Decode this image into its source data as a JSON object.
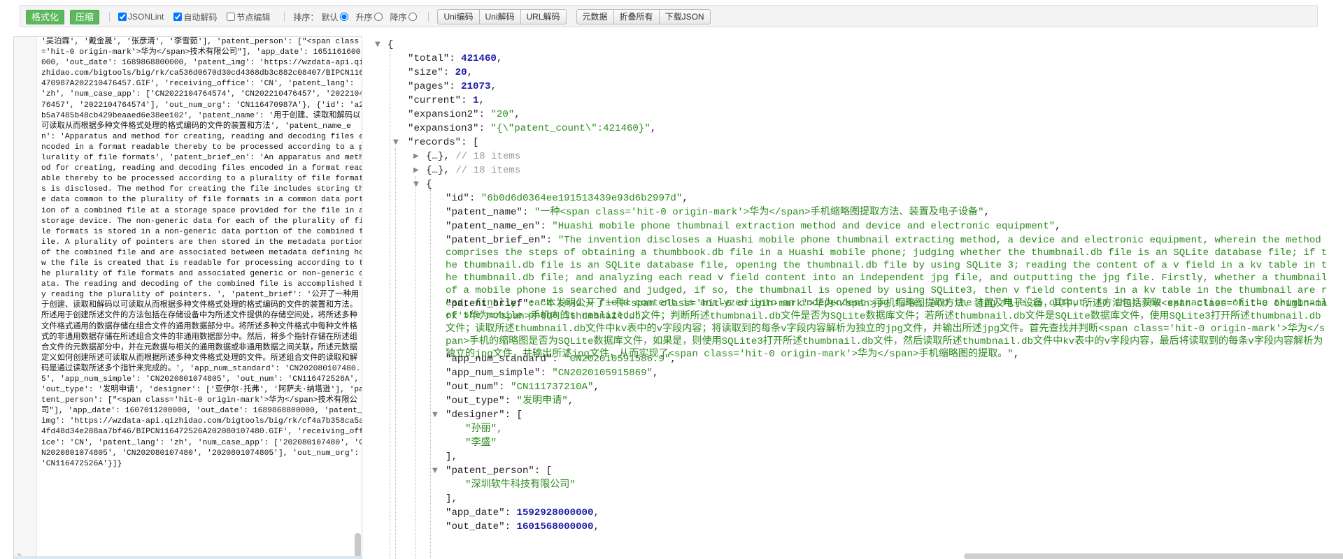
{
  "toolbar": {
    "format_label": "格式化",
    "compress_label": "压缩",
    "jsonlint_label": "JSONLint",
    "auto_decode_label": "自动解码",
    "node_edit_label": "节点编辑",
    "sort_label": "排序：",
    "sort_default": "默认",
    "sort_asc": "升序",
    "sort_desc": "降序",
    "uni_encode": "Uni编码",
    "uni_decode": "Uni解码",
    "url_decode": "URL解码",
    "raw_data": "元数据",
    "collapse_all": "折叠所有",
    "download_json": "下载JSON"
  },
  "left_editor": {
    "line_number": "2",
    "raw_text": "'吴泊霖', '戴金晟', '张彦清', '李雪茹'], 'patent_person': [\"<span class='hit-0 origin-mark'>华为</span>技术有限公司\"], 'app_date': 1651161600000, 'out_date': 1689868800000, 'patent_img': 'https://wzdata-api.qizhidao.com/bigtools/big/rk/ca536d0670d30cd4368db3c882c08407/BIPCN116470987A202210476457.GIF', 'receiving_office': 'CN', 'patent_lang': 'zh', 'num_case_app': ['CN2022104764574', 'CN202210476457', '202210476457', '2022104764574'], 'out_num_org': 'CN116470987A'}, {'id': 'a2b5a7485b48cb429beaaed6e38ee102', 'patent_name': '用于创建、读取和解码以可读取从而根据多种文件格式处理的格式编码的文件的装置和方法', 'patent_name_en': 'Apparatus and method for creating, reading and decoding files encoded in a format readable thereby to be processed according to a plurality of file formats', 'patent_brief_en': 'An apparatus and method for creating, reading and decoding files encoded in a format readable thereby to be processed according to a plurality of file formats is disclosed. The method for creating the file includes storing the data common to the plurality of file formats in a common data portion of a combined file at a storage space provided for the file in a storage device. The non-generic data for each of the plurality of file formats is stored in a non-generic data portion of the combined file. A plurality of pointers are then stored in the metadata portion of the combined file and are associated between metadata defining how the file is created that is readable for processing according to the plurality of file formats and associated generic or non-generic data. The reading and decoding of the combined file is accomplished by reading the plurality of pointers. ', 'patent_brief': '公开了一种用于创建、读取和解码以可读取从而根据多种文件格式处理的格式编码的文件的装置和方法。所述用于创建所述文件的方法包括在存储设备中为所述文件提供的存储空间处，将所述多种文件格式通用的数据存储在组合文件的通用数据部分中。将所述多种文件格式中每种文件格式的非通用数据存储在所述组合文件的非通用数据部分中。然后，将多个指针存储在所述组合文件的元数据部分中，并在元数据与相关的通用数据或非通用数据之间关联，所述元数据定义如何创建所述可读取从而根据所述多种文件格式处理的文件。所述组合文件的读取和解码是通过读取所述多个指针来完成的。', 'app_num_standard': 'CN202080107480.5', 'app_num_simple': 'CN2020801074805', 'out_num': 'CN116472526A', 'out_type': '发明申请', 'designer': ['亚伊尔·托弗', '阿萨夫·纳塔逊'], 'patent_person': [\"<span class='hit-0 origin-mark'>华为</span>技术有限公司\"], 'app_date': 1607011200000, 'out_date': 1689868800000, 'patent_img': 'https://wzdata-api.qizhidao.com/bigtools/big/rk/cf4a7b358ca5a4fd48d34e288aa7bf46/BIPCN116472526A202080107480.GIF', 'receiving_office': 'CN', 'patent_lang': 'zh', 'num_case_app': ['202080107480', 'CN2020801074805', 'CN202080107480', '2020801074805'], 'out_num_org': 'CN116472526A'}]}"
  },
  "tree": {
    "open_brace": "{",
    "close_brace": "}",
    "total_key": "\"total\"",
    "total_val": "421460",
    "size_key": "\"size\"",
    "size_val": "20",
    "pages_key": "\"pages\"",
    "pages_val": "21073",
    "current_key": "\"current\"",
    "current_val": "1",
    "expansion2_key": "\"expansion2\"",
    "expansion2_val": "\"20\"",
    "expansion3_key": "\"expansion3\"",
    "expansion3_val": "\"{\\\"patent_count\\\":421460}\"",
    "records_key": "\"records\"",
    "records_open": "[",
    "collapsed_obj": "{…},",
    "collapsed_comment": "// 18 items",
    "id_key": "\"id\"",
    "id_val": "\"6b0d6d0364ee191513439e93d6b2997d\"",
    "patent_name_key": "\"patent_name\"",
    "patent_name_val": "\"一种<span class='hit-0 origin-mark'>华为</span>手机缩略图提取方法、装置及电子设备\"",
    "patent_name_en_key": "\"patent_name_en\"",
    "patent_name_en_val": "\"Huashi mobile phone thumbnail extraction method and device and electronic equipment\"",
    "patent_brief_en_key": "\"patent_brief_en\"",
    "patent_brief_en_val": "\"The invention discloses a Huashi mobile phone thumbnail extracting method, a device and electronic equipment, wherein the method comprises the steps of obtaining a thumbbook.db file in a Huashi mobile phone; judging whether the thumbnail.db file is an SQLite database file; if the thumbnail.db file is an SQLite database file, opening the thumbnail.db file by using SQLite 3; reading the content of a v field in a kv table in the thumbnail.db file; and analyzing each read v field content into an independent jpg file, and outputting the jpg file. Firstly, whether a thumbnail of a mobile phone is searched and judged, if so, the thumbnail is opened by using SQLite3, then v field contents in a kv table in the thumbnail are read, finally, each read v field content is analyzed into an independent jpg file, and the jpg file is output, so that the extraction of the thumbnail of the mobile phone is realized.\"",
    "patent_brief_key": "\"patent_brief\"",
    "patent_brief_val": "\"本发明公开了一种<span class='hit-0 origin-mark'>华为</span>手机缩略图提取方法、装置及电子设备，其中，所述方法包括获取<span class='hit-0 origin-mark'>华为</span>手机内的thumbnail.db文件；判断所述thumbnail.db文件是否为SQLite数据库文件；若所述thumbnail.db文件是SQLite数据库文件，使用SQLite3打开所述thumbnail.db文件；读取所述thumbnail.db文件中kv表中的v字段内容；将读取到的每条v字段内容解析为独立的jpg文件，并输出所述jpg文件。首先查找并判断<span class='hit-0 origin-mark'>华为</span>手机的缩略图是否为SQLite数据库文件，如果是，则使用SQLite3打开所述thumbnail.db文件，然后读取所述thumbnail.db文件中kv表中的v字段内容，最后将读取到的每条v字段内容解析为独立的jpg文件，并输出所述jpg文件，从而实现了<span class='hit-0 origin-mark'>华为</span>手机缩略图的提取。\"",
    "app_num_standard_key": "\"app_num_standard\"",
    "app_num_standard_val": "\"CN202010591586.9\"",
    "app_num_simple_key": "\"app_num_simple\"",
    "app_num_simple_val": "\"CN2020105915869\"",
    "out_num_key": "\"out_num\"",
    "out_num_val": "\"CN111737210A\"",
    "out_type_key": "\"out_type\"",
    "out_type_val": "\"发明申请\"",
    "designer_key": "\"designer\"",
    "designer_0": "\"孙丽\",",
    "designer_1": "\"李盛\"",
    "arr_close": "],",
    "patent_person_key": "\"patent_person\"",
    "patent_person_0": "\"深圳软牛科技有限公司\"",
    "app_date_key": "\"app_date\"",
    "app_date_val": "1592928000000",
    "out_date_key": "\"out_date\"",
    "out_date_val": "1601568000000"
  }
}
